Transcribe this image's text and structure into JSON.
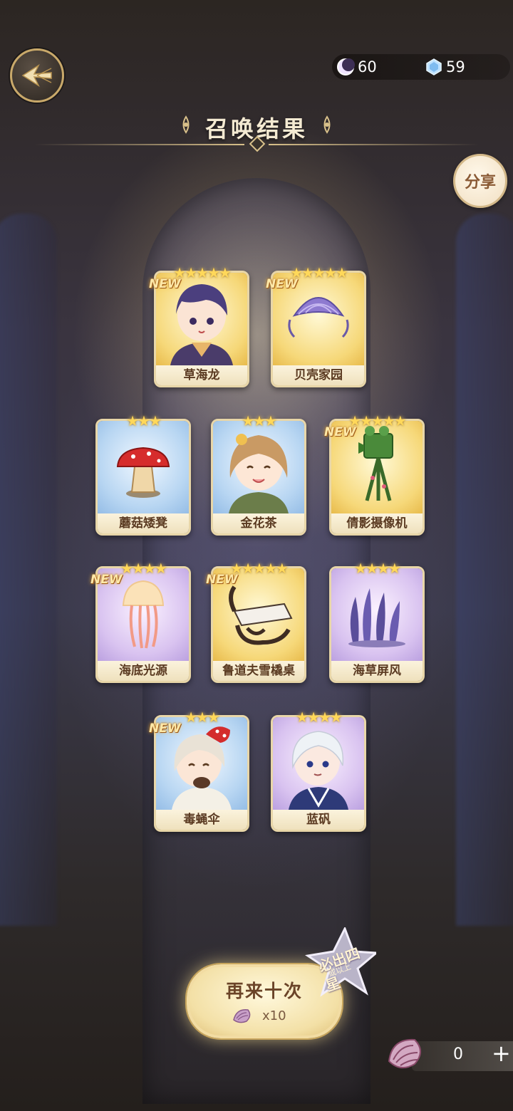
{
  "header": {
    "title": "召唤结果",
    "currency_moon": "60",
    "currency_crystal": "59",
    "share_label": "分享"
  },
  "cards": [
    {
      "name": "草海龙",
      "stars": "★★★★★",
      "new": "NEW",
      "rarity": "gold"
    },
    {
      "name": "贝壳家园",
      "stars": "★★★★★",
      "new": "NEW",
      "rarity": "gold"
    },
    {
      "name": "蘑菇矮凳",
      "stars": "★★★",
      "new": "",
      "rarity": "blue"
    },
    {
      "name": "金花茶",
      "stars": "★★★",
      "new": "",
      "rarity": "blue"
    },
    {
      "name": "倩影摄像机",
      "stars": "★★★★★",
      "new": "NEW",
      "rarity": "gold"
    },
    {
      "name": "海底光源",
      "stars": "★★★★",
      "new": "NEW",
      "rarity": "purple"
    },
    {
      "name": "鲁道夫雪橇桌",
      "stars": "★★★★★",
      "new": "NEW",
      "rarity": "gold"
    },
    {
      "name": "海草屏风",
      "stars": "★★★★",
      "new": "",
      "rarity": "purple"
    },
    {
      "name": "毒蝇伞",
      "stars": "★★★",
      "new": "NEW",
      "rarity": "blue"
    },
    {
      "name": "蓝矾",
      "stars": "★★★★",
      "new": "",
      "rarity": "purple"
    }
  ],
  "summon_again": {
    "label": "再来十次",
    "cost": "x10",
    "guarantee_main": "必出四星",
    "guarantee_sub": "或以上"
  },
  "shell": {
    "count": "0",
    "plus": "+"
  },
  "colors": {
    "gold_card": "#f6d879",
    "purple_card": "#d9c3f0",
    "blue_card": "#b8d6f2",
    "star": "#ffd85a",
    "title_text": "#f4ead2"
  }
}
